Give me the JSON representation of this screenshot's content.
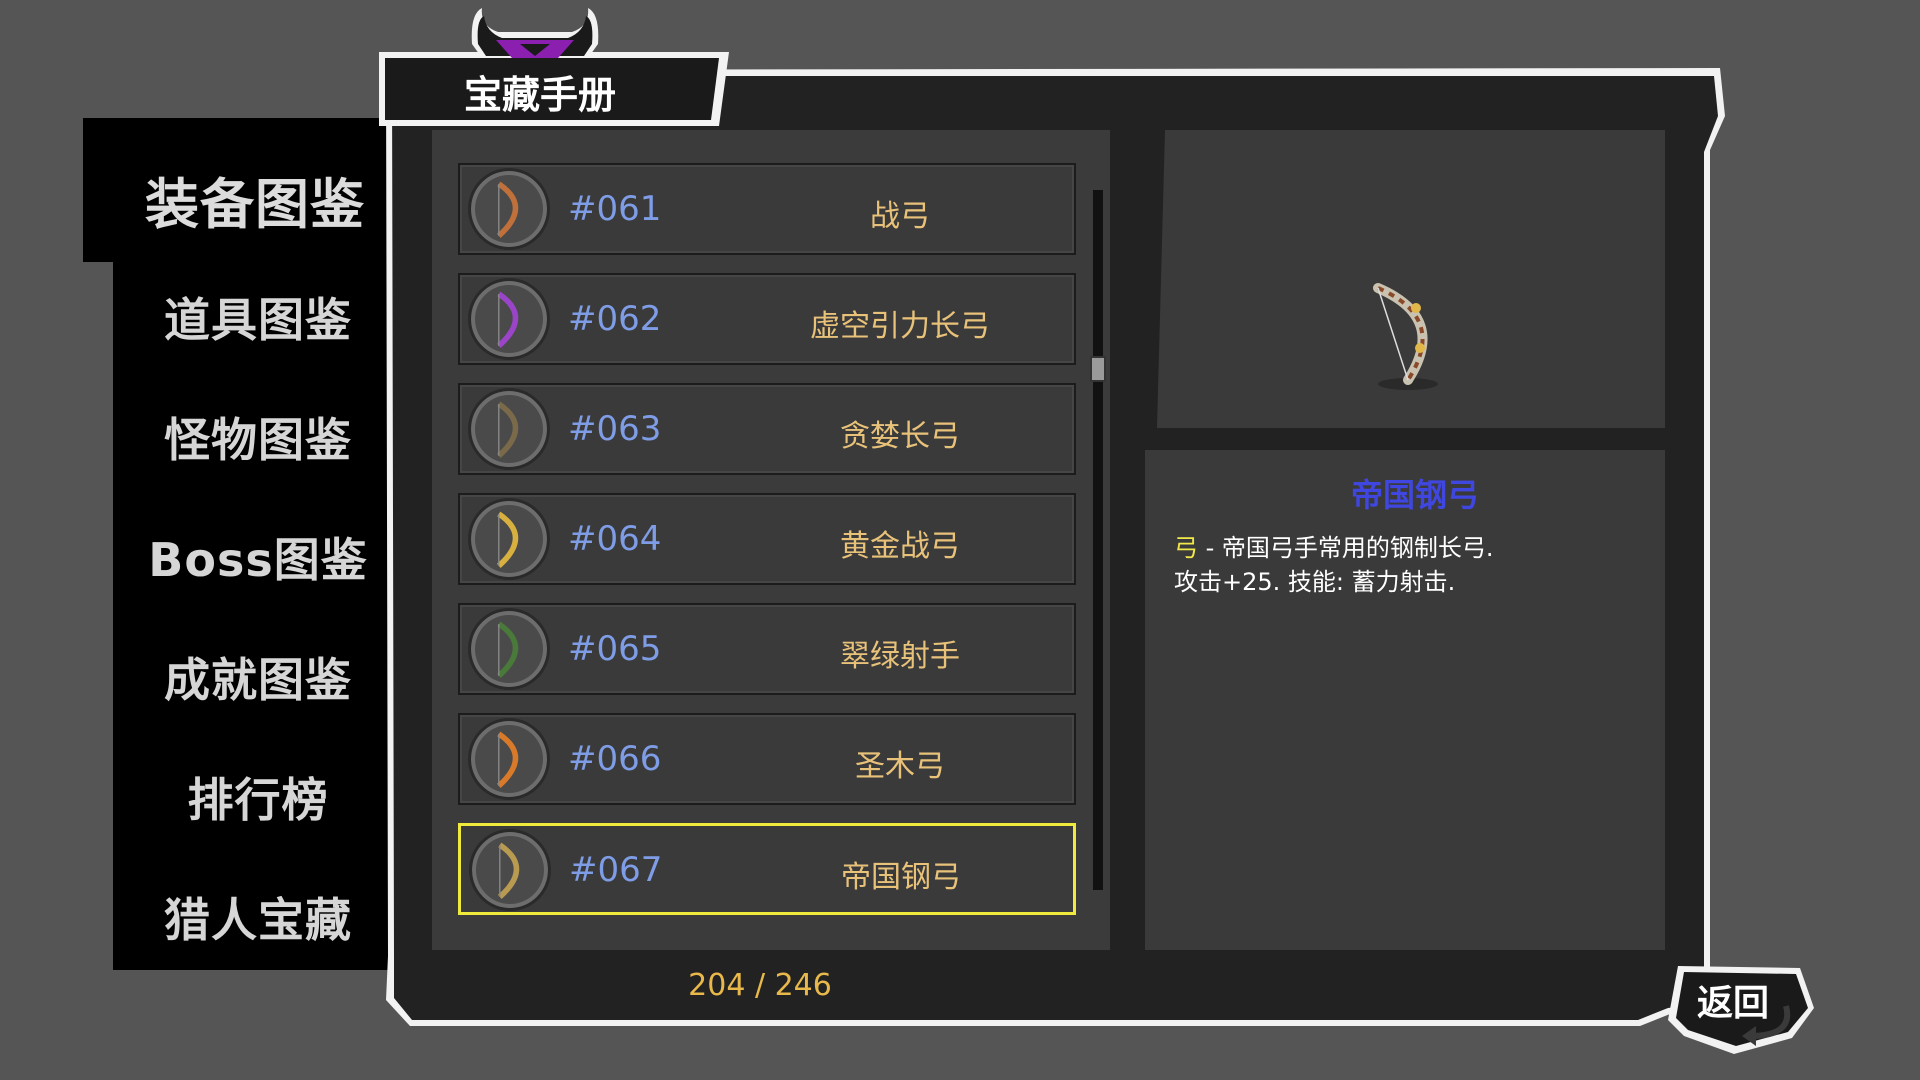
{
  "header": {
    "title": "宝藏手册"
  },
  "sidebar": {
    "items": [
      {
        "label": "装备图鉴",
        "active": true
      },
      {
        "label": "道具图鉴",
        "active": false
      },
      {
        "label": "怪物图鉴",
        "active": false
      },
      {
        "label": "Boss图鉴",
        "active": false
      },
      {
        "label": "成就图鉴",
        "active": false
      },
      {
        "label": "排行榜",
        "active": false
      },
      {
        "label": "猎人宝藏",
        "active": false
      }
    ]
  },
  "list": {
    "items": [
      {
        "number": "#061",
        "name": "战弓",
        "icon": "bow-icon",
        "accent": "#c0703a"
      },
      {
        "number": "#062",
        "name": "虚空引力长弓",
        "icon": "bow-icon",
        "accent": "#9a45c8"
      },
      {
        "number": "#063",
        "name": "贪婪长弓",
        "icon": "bow-icon",
        "accent": "#7a6a4a"
      },
      {
        "number": "#064",
        "name": "黄金战弓",
        "icon": "bow-icon",
        "accent": "#d8b040"
      },
      {
        "number": "#065",
        "name": "翠绿射手",
        "icon": "bow-icon",
        "accent": "#4a7a3a"
      },
      {
        "number": "#066",
        "name": "圣木弓",
        "icon": "bow-icon",
        "accent": "#d87a2a"
      },
      {
        "number": "#067",
        "name": "帝国钢弓",
        "icon": "bow-icon",
        "accent": "#b89a50",
        "selected": true
      }
    ],
    "counter": "204 / 246"
  },
  "detail": {
    "title": "帝国钢弓",
    "type": "弓",
    "line1": " - 帝国弓手常用的钢制长弓.",
    "line2": "攻击+25. 技能: 蓄力射击."
  },
  "back_button": {
    "label": "返回"
  },
  "colors": {
    "background": "#555555",
    "number": "#7f9de6",
    "item_name": "#e9c27a",
    "selected_border": "#f0ea3c",
    "detail_title": "#3f47e0",
    "counter": "#e8b84a"
  }
}
